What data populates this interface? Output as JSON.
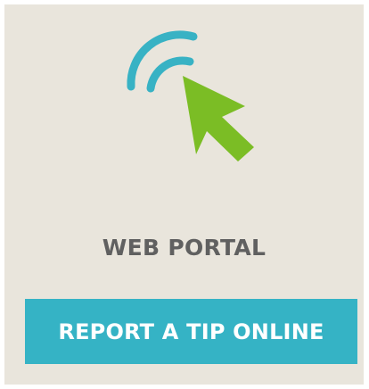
{
  "icon": {
    "name": "web-click-icon",
    "wave_color": "#38b2c4",
    "arrow_color": "#7bbd25"
  },
  "title": "WEB PORTAL",
  "cta": {
    "label": "REPORT A TIP ONLINE",
    "color": "#35b3c5",
    "text_color": "#ffffff"
  },
  "colors": {
    "card_background": "#e9e5dc",
    "title_color": "#606060"
  }
}
